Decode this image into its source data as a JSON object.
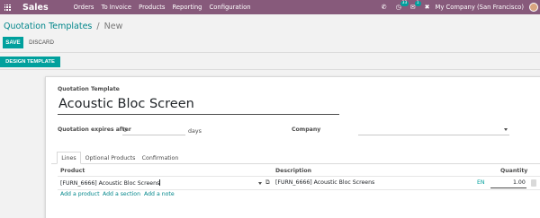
{
  "navbar": {
    "app_name": "Sales",
    "menu": [
      "Orders",
      "To Invoice",
      "Products",
      "Reporting",
      "Configuration"
    ],
    "activity_badge": "33",
    "message_badge": "1",
    "company": "My Company (San Francisco)"
  },
  "breadcrumb": {
    "parent": "Quotation Templates",
    "separator": "/",
    "current": "New"
  },
  "buttons": {
    "save": "SAVE",
    "discard": "DISCARD",
    "design_template": "DESIGN TEMPLATE"
  },
  "form": {
    "template_label": "Quotation Template",
    "template_name": "Acoustic Bloc Screen",
    "expires_label": "Quotation expires after",
    "expires_value": "0",
    "expires_unit": "days",
    "company_label": "Company",
    "company_value": ""
  },
  "tabs": [
    "Lines",
    "Optional Products",
    "Confirmation"
  ],
  "lines": {
    "headers": {
      "product": "Product",
      "description": "Description",
      "quantity": "Quantity"
    },
    "rows": [
      {
        "product": "[FURN_6666] Acoustic Bloc Screens",
        "description": "[FURN_6666] Acoustic Bloc Screens",
        "lang": "EN",
        "quantity": "1.00"
      }
    ],
    "add_product": "Add a product",
    "add_section": "Add a section",
    "add_note": "Add a note"
  },
  "colors": {
    "navbar": "#875a7b",
    "primary": "#00a09d",
    "link": "#00868a"
  }
}
